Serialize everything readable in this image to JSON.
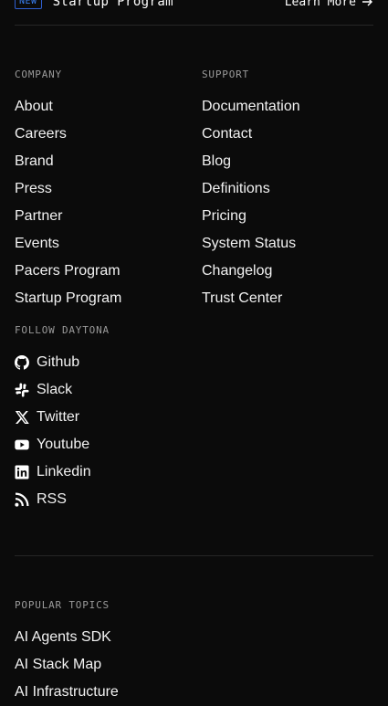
{
  "banner": {
    "badge": "NEW",
    "title": "Startup Program",
    "link_label": "Learn More"
  },
  "company": {
    "label": "COMPANY",
    "items": [
      "About",
      "Careers",
      "Brand",
      "Press",
      "Partner",
      "Events",
      "Pacers Program",
      "Startup Program"
    ]
  },
  "support": {
    "label": "SUPPORT",
    "items": [
      "Documentation",
      "Contact",
      "Blog",
      "Definitions",
      "Pricing",
      "System Status",
      "Changelog",
      "Trust Center"
    ]
  },
  "follow": {
    "label": "FOLLOW DAYTONA",
    "items": [
      {
        "icon": "github-icon",
        "label": "Github"
      },
      {
        "icon": "slack-icon",
        "label": "Slack"
      },
      {
        "icon": "x-twitter-icon",
        "label": "Twitter"
      },
      {
        "icon": "youtube-icon",
        "label": "Youtube"
      },
      {
        "icon": "linkedin-icon",
        "label": "Linkedin"
      },
      {
        "icon": "rss-icon",
        "label": "RSS"
      }
    ]
  },
  "popular": {
    "label": "POPULAR TOPICS",
    "items": [
      "AI Agents SDK",
      "AI Stack Map",
      "AI Infrastructure"
    ]
  },
  "colors": {
    "background": "#0b0b0b",
    "text": "#ffffff",
    "muted": "#9a9a9a",
    "badge": "#3b82f6",
    "divider": "#262626"
  }
}
